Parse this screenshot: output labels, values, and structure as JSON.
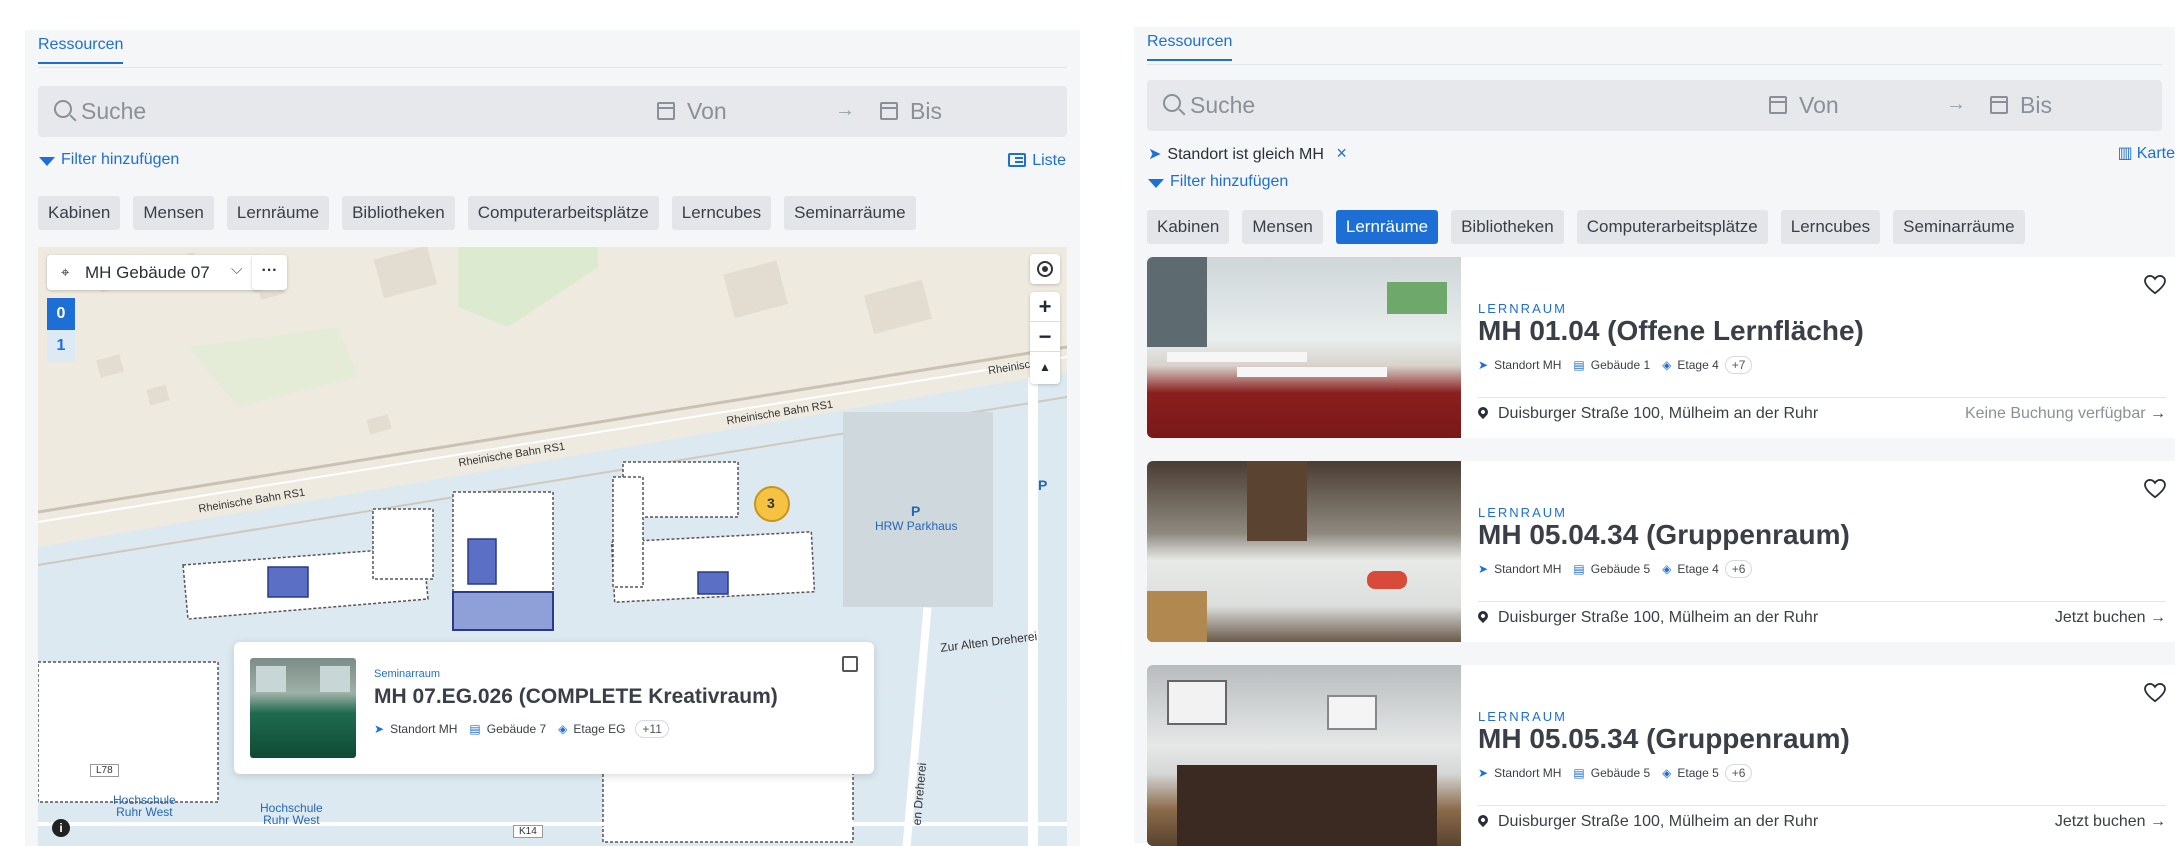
{
  "left": {
    "tab": "Ressourcen",
    "search": {
      "placeholder": "Suche",
      "from": "Von",
      "arrow": "→",
      "to": "Bis"
    },
    "filter_add": "Filter hinzufügen",
    "view_toggle": "Liste",
    "categories": [
      "Kabinen",
      "Mensen",
      "Lernräume",
      "Bibliotheken",
      "Computerarbeitsplätze",
      "Lerncubes",
      "Seminarräume"
    ],
    "map": {
      "location_select": "MH Gebäude 07",
      "more": "···",
      "floors": [
        "0",
        "1"
      ],
      "active_floor": "0",
      "zoom_in": "+",
      "zoom_out": "−",
      "cluster_count": "3",
      "labels": {
        "rail1": "Rheinische Bahn RS1",
        "rail2": "Rheinische Bahn RS1",
        "rail3": "Rheinische Bahn RS1",
        "rail4": "Rheinisc",
        "parking_p": "P",
        "parking_name": "HRW Parkhaus",
        "p_right": "P",
        "street": "Zur Alten Dreherei",
        "street_vertical": "en Dreherei",
        "road_l78": "L78",
        "road_k14": "K14",
        "stop1": "Hochschule\nRuhr West",
        "stop2": "Hochschule\nRuhr West",
        "info": "i"
      },
      "popup": {
        "type": "Seminarraum",
        "title": "MH 07.EG.026 (COMPLETE Kreativraum)",
        "standort": "Standort MH",
        "gebaeude": "Gebäude 7",
        "etage": "Etage EG",
        "more": "+11"
      }
    }
  },
  "right": {
    "tab": "Ressourcen",
    "search": {
      "placeholder": "Suche",
      "from": "Von",
      "arrow": "→",
      "to": "Bis"
    },
    "active_filter": "Standort ist gleich MH",
    "active_filter_remove": "×",
    "filter_add": "Filter hinzufügen",
    "view_toggle": "Karte",
    "categories": [
      "Kabinen",
      "Mensen",
      "Lernräume",
      "Bibliotheken",
      "Computerarbeitsplätze",
      "Lerncubes",
      "Seminarräume"
    ],
    "active_category": "Lernräume",
    "results": [
      {
        "type": "LERNRAUM",
        "title": "MH 01.04 (Offene Lernfläche)",
        "standort": "Standort MH",
        "gebaeude": "Gebäude 1",
        "etage": "Etage 4",
        "more": "+7",
        "address": "Duisburger Straße 100, Mülheim an der Ruhr",
        "action": "Keine Buchung verfügbar",
        "action_arrow": "→",
        "action_color": "#8b9098"
      },
      {
        "type": "LERNRAUM",
        "title": "MH 05.04.34 (Gruppenraum)",
        "standort": "Standort MH",
        "gebaeude": "Gebäude 5",
        "etage": "Etage 4",
        "more": "+6",
        "address": "Duisburger Straße 100, Mülheim an der Ruhr",
        "action": "Jetzt buchen",
        "action_arrow": "→",
        "action_color": "#3a3f47"
      },
      {
        "type": "LERNRAUM",
        "title": "MH 05.05.34 (Gruppenraum)",
        "standort": "Standort MH",
        "gebaeude": "Gebäude 5",
        "etage": "Etage 5",
        "more": "+6",
        "address": "Duisburger Straße 100, Mülheim an der Ruhr",
        "action": "Jetzt buchen",
        "action_arrow": "→",
        "action_color": "#3a3f47"
      }
    ]
  },
  "colors": {
    "accent": "#1d6fd6",
    "map_bg": "#eeeadf",
    "campus": "#dce9f2",
    "cluster": "#f5c242"
  }
}
